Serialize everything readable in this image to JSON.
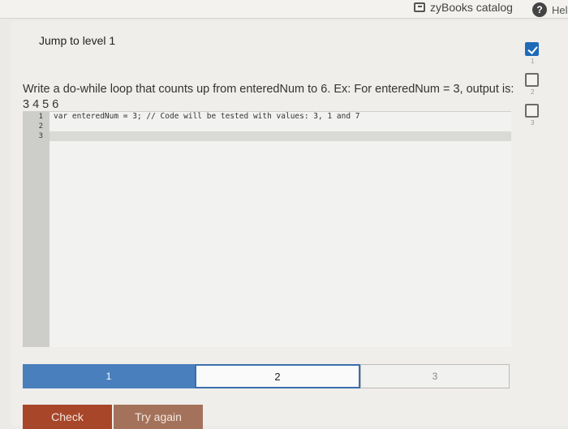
{
  "topbar": {
    "catalog_label": "zyBooks catalog",
    "help_label": "Help"
  },
  "activity": {
    "title": "Jump to level 1",
    "prompt": "Write a do-while loop that counts up from enteredNum to 6. Ex: For enteredNum = 3, output is: 3 4 5 6"
  },
  "levels": [
    {
      "num": "1",
      "done": true
    },
    {
      "num": "2",
      "done": false
    },
    {
      "num": "3",
      "done": false
    }
  ],
  "editor": {
    "line_numbers": [
      "1",
      "2",
      "3"
    ],
    "lines": [
      "var enteredNum = 3; // Code will be tested with values: 3, 1 and 7",
      "",
      ""
    ],
    "current_line": 3
  },
  "progress": {
    "segments": [
      "1",
      "2",
      "3"
    ],
    "active": 2
  },
  "buttons": {
    "check": "Check",
    "try_again": "Try again"
  },
  "colors": {
    "accent": "#1f6ab8",
    "progress_done": "#4a7fbd",
    "check_button": "#a8462a",
    "try_button": "#a4725b"
  }
}
